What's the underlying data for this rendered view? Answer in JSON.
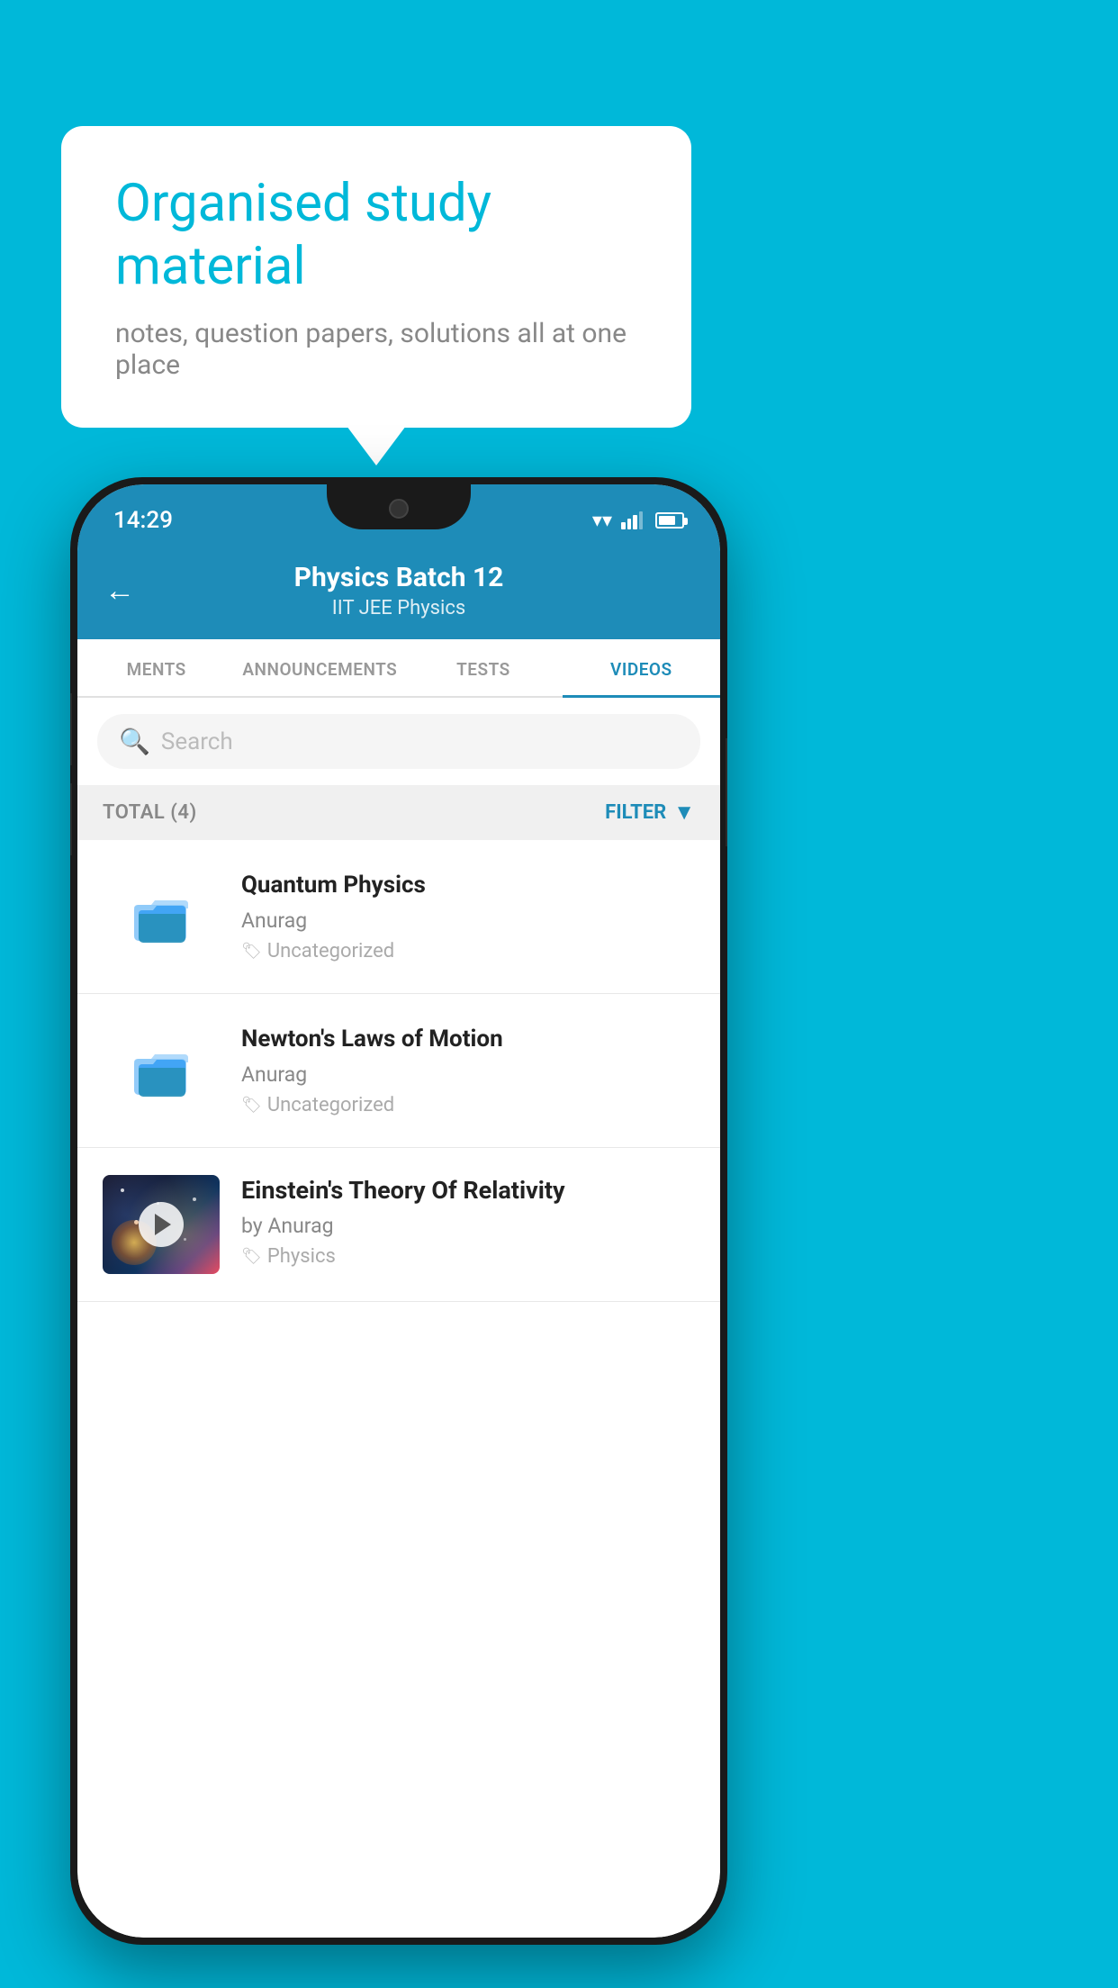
{
  "background_color": "#00b8d9",
  "bubble": {
    "title": "Organised study material",
    "subtitle": "notes, question papers, solutions all at one place"
  },
  "status_bar": {
    "time": "14:29",
    "icons": [
      "wifi",
      "signal",
      "battery"
    ]
  },
  "header": {
    "back_label": "←",
    "title": "Physics Batch 12",
    "subtitle": "IIT JEE   Physics"
  },
  "tabs": [
    {
      "label": "MENTS",
      "active": false
    },
    {
      "label": "ANNOUNCEMENTS",
      "active": false
    },
    {
      "label": "TESTS",
      "active": false
    },
    {
      "label": "VIDEOS",
      "active": true
    }
  ],
  "search": {
    "placeholder": "Search"
  },
  "filter_bar": {
    "total_label": "TOTAL (4)",
    "filter_label": "FILTER"
  },
  "videos": [
    {
      "title": "Quantum Physics",
      "author": "Anurag",
      "tag": "Uncategorized",
      "has_thumbnail": false
    },
    {
      "title": "Newton's Laws of Motion",
      "author": "Anurag",
      "tag": "Uncategorized",
      "has_thumbnail": false
    },
    {
      "title": "Einstein's Theory Of Relativity",
      "author": "by Anurag",
      "tag": "Physics",
      "has_thumbnail": true
    }
  ]
}
